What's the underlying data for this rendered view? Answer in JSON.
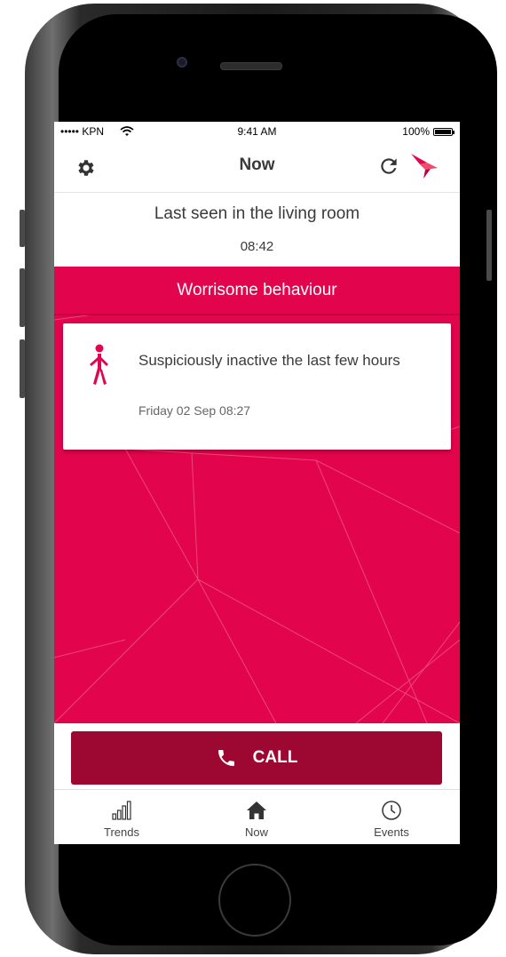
{
  "status_bar": {
    "carrier": "••••• KPN",
    "time": "9:41 AM",
    "battery": "100%"
  },
  "nav": {
    "title": "Now",
    "settings_icon": "gear-icon",
    "refresh_icon": "refresh-icon",
    "logo_icon": "bird-logo-icon"
  },
  "last_seen": {
    "text": "Last seen in the living room",
    "time": "08:42"
  },
  "alert": {
    "header": "Worrisome behaviour",
    "card": {
      "icon": "walking-person-icon",
      "title": "Suspiciously inactive the last few hours",
      "date": "Friday 02 Sep 08:27"
    }
  },
  "call_button": {
    "label": "CALL",
    "icon": "phone-icon"
  },
  "tabs": [
    {
      "label": "Trends",
      "icon": "trends-chart-icon"
    },
    {
      "label": "Now",
      "icon": "home-icon"
    },
    {
      "label": "Events",
      "icon": "clock-icon"
    }
  ],
  "colors": {
    "accent": "#e2044d",
    "call_button": "#9c0832"
  }
}
